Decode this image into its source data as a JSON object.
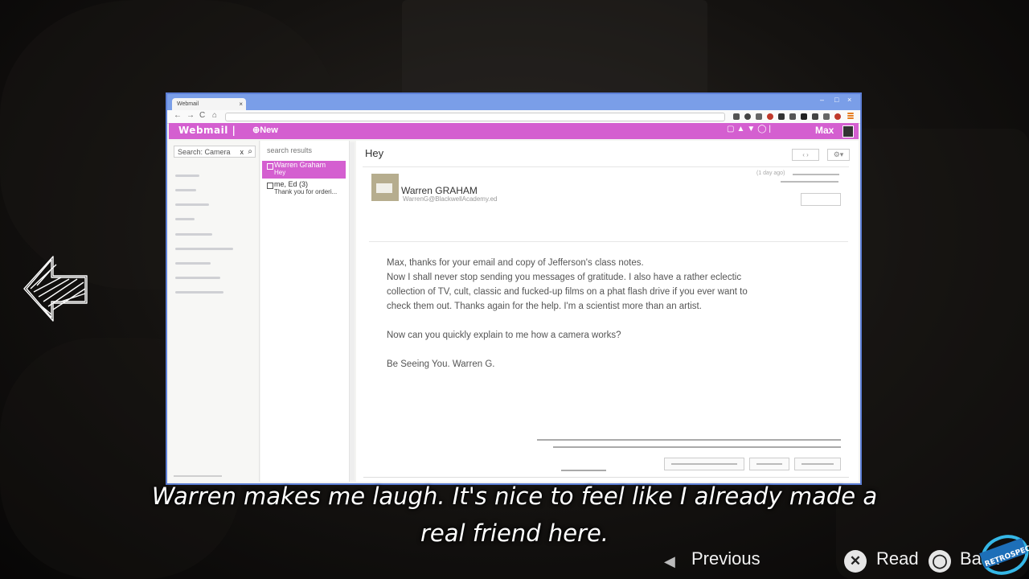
{
  "browser": {
    "tab_title": "Webmail",
    "tab_close": "×",
    "window_controls": [
      "–",
      "□",
      "×"
    ],
    "nav_glyphs": [
      "←",
      "→",
      "C",
      "⌂"
    ]
  },
  "app": {
    "brand": "Webmail |",
    "new_label": "⊕New",
    "appbar_icons": "▢▲▼◯|",
    "user_name": "Max"
  },
  "left_pane": {
    "search_value": "Search: Camera",
    "search_clear": "x",
    "search_icon": "⌕"
  },
  "message_list": {
    "header": "search results",
    "messages": [
      {
        "from": "Warren Graham",
        "subject": "Hey",
        "selected": true
      },
      {
        "from": "me, Ed (3)",
        "subject": "Thank you for orderi...",
        "selected": false
      }
    ]
  },
  "email": {
    "subject": "Hey",
    "nav": "‹ ›",
    "settings": "⚙▾",
    "date": "(1 day ago)",
    "sender_name": "Warren GRAHAM",
    "sender_email": "WarrenG@BlackwellAcademy.ed",
    "body": [
      "Max, thanks for your email and copy of Jefferson's class notes.\nNow I shall never stop sending you messages of gratitude. I also have a rather eclectic collection of TV, cult, classic and fucked-up films on a phat flash drive if you ever want to check them out. Thanks again for the help. I'm a scientist more than an artist.",
      "Now can you quickly explain to me how a camera works?",
      "Be Seeing You. Warren G."
    ]
  },
  "subtitle": {
    "line1": "Warren makes me laugh.  It's nice to feel like I already made a",
    "line2": "real friend here."
  },
  "prompts": {
    "previous": "Previous",
    "read": "Read",
    "back": "Back",
    "read_button": "✕",
    "back_button": "◯"
  },
  "colors": {
    "accent": "#d45fd0",
    "window_frame": "#7a9ee8"
  }
}
